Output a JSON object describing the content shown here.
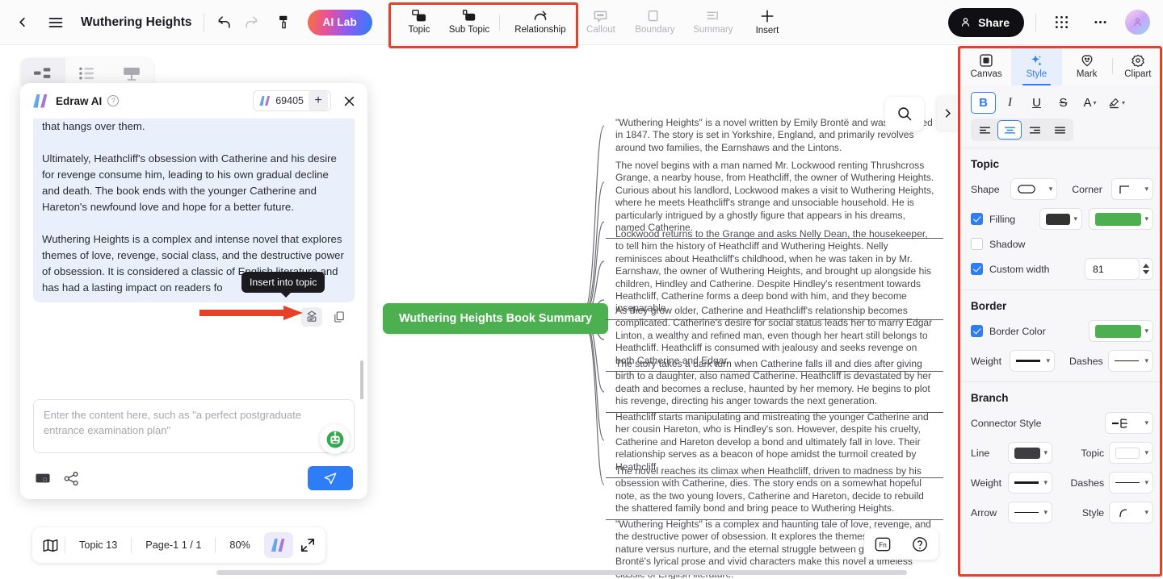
{
  "topbar": {
    "back_icon": "chevron-left-icon",
    "menu_icon": "hamburger-menu-icon",
    "doc_title": "Wuthering Heights",
    "undo_icon": "undo-icon",
    "redo_icon": "redo-icon",
    "format_painter_icon": "format-painter-icon",
    "ai_lab_label": "AI Lab",
    "tools": [
      {
        "label": "Topic",
        "icon": "topic-icon",
        "disabled": false
      },
      {
        "label": "Sub Topic",
        "icon": "sub-topic-icon",
        "disabled": false
      },
      {
        "label": "Relationship",
        "icon": "relationship-icon",
        "disabled": false
      },
      {
        "label": "Callout",
        "icon": "callout-icon",
        "disabled": true
      },
      {
        "label": "Boundary",
        "icon": "boundary-icon",
        "disabled": true
      },
      {
        "label": "Summary",
        "icon": "summary-icon",
        "disabled": true
      },
      {
        "label": "Insert",
        "icon": "insert-plus-icon",
        "disabled": false
      }
    ],
    "share_label": "Share",
    "share_icon": "person-icon",
    "apps_icon": "grid-apps-icon",
    "more_icon": "more-horizontal-icon",
    "avatar_icon": "user-avatar"
  },
  "canvas": {
    "view_tabs": [
      {
        "name": "mindmap-view",
        "icon": "mindmap-icon",
        "active": true
      },
      {
        "name": "outline-view",
        "icon": "outline-list-icon",
        "active": false
      },
      {
        "name": "presentation-view",
        "icon": "presentation-icon",
        "active": false
      }
    ],
    "search_icon": "search-icon",
    "collapse_icon": "chevron-right-icon",
    "root_topic": "Wuthering Heights Book Summary",
    "root_color": "#4caf50",
    "nodes": [
      "\"Wuthering Heights\" is a novel written by Emily Brontë and was published in 1847. The story is set in Yorkshire, England, and primarily revolves around two families, the Earnshaws and the Lintons.",
      "The novel begins with a man named Mr. Lockwood renting Thrushcross Grange, a nearby house, from Heathcliff, the owner of Wuthering Heights. Curious about his landlord, Lockwood makes a visit to Wuthering Heights, where he meets Heathcliff's strange and unsociable household. He is particularly intrigued by a ghostly figure that appears in his dreams, named Catherine.",
      "Lockwood returns to the Grange and asks Nelly Dean, the housekeeper, to tell him the history of Heathcliff and Wuthering Heights. Nelly reminisces about Heathcliff's childhood, when he was taken in by Mr. Earnshaw, the owner of Wuthering Heights, and brought up alongside his children, Hindley and Catherine. Despite Hindley's resentment towards Heathcliff, Catherine forms a deep bond with him, and they become inseparable.",
      "As they grow older, Catherine and Heathcliff's relationship becomes complicated. Catherine's desire for social status leads her to marry Edgar Linton, a wealthy and refined man, even though her heart still belongs to Heathcliff. Heathcliff is consumed with jealousy and seeks revenge on both Catherine and Edgar.",
      "The story takes a dark turn when Catherine falls ill and dies after giving birth to a daughter, also named Catherine. Heathcliff is devastated by her death and becomes a recluse, haunted by her memory. He begins to plot his revenge, directing his anger towards the next generation.",
      "Heathcliff starts manipulating and mistreating the younger Catherine and her cousin Hareton, who is Hindley's son. However, despite his cruelty, Catherine and Hareton develop a bond and ultimately fall in love. Their relationship serves as a beacon of hope amidst the turmoil created by Heathcliff.",
      "The novel reaches its climax when Heathcliff, driven to madness by his obsession with Catherine, dies. The story ends on a somewhat hopeful note, as the two young lovers, Catherine and Hareton, decide to rebuild the shattered family bond and bring peace to Wuthering Heights.",
      "\"Wuthering Heights\" is a complex and haunting tale of love, revenge, and the destructive power of obsession. It explores the themes of social class, nature versus nurture, and the eternal struggle between good and evil. Brontë's lyrical prose and vivid characters make this novel a timeless classic of English literature."
    ]
  },
  "ai_panel": {
    "logo_icon": "edraw-logo-icon",
    "title": "Edraw AI",
    "help_icon": "help-circle-icon",
    "credits_value": "69405",
    "credits_icon": "edraw-mini-logo-icon",
    "add_credits_icon": "plus-icon",
    "close_icon": "close-icon",
    "message_paragraphs": [
      "acles they face, the young couple attempts to build a relationship and overcome the legacy of hatred and revenge that hangs over them.",
      "Ultimately, Heathcliff's obsession with Catherine and his desire for revenge consume him, leading to his own gradual decline and death. The book ends with the younger Catherine and Hareton's newfound love and hope for a better future.",
      "Wuthering Heights is a complex and intense novel that explores themes of love, revenge, social class, and the destructive power of obsession. It is considered a classic of English literature and has had a lasting impact on readers fo"
    ],
    "tooltip": "Insert into topic",
    "insert_icon": "insert-into-topic-icon",
    "copy_icon": "copy-icon",
    "input_placeholder": "Enter the content here, such as \"a perfect postgraduate entrance examination plan\"",
    "input_value": "",
    "robot_icon": "ai-robot-icon",
    "attach_icon": "image-upload-icon",
    "flow_icon": "flowchart-icon",
    "send_icon": "send-paper-plane-icon",
    "send_color": "#2f7df6"
  },
  "right_panel": {
    "tabs": [
      {
        "label": "Canvas",
        "icon": "canvas-icon",
        "active": false
      },
      {
        "label": "Style",
        "icon": "style-sparkle-icon",
        "active": true
      },
      {
        "label": "Mark",
        "icon": "mark-smiley-icon",
        "active": false
      },
      {
        "label": "Clipart",
        "icon": "clipart-icon",
        "active": false
      }
    ],
    "format": {
      "bold": {
        "label": "B",
        "icon": "bold-icon",
        "active": true
      },
      "italic": {
        "label": "I",
        "icon": "italic-icon",
        "active": false
      },
      "underline": {
        "label": "U",
        "icon": "underline-icon",
        "active": false
      },
      "strikethrough": {
        "label": "S",
        "icon": "strikethrough-icon",
        "active": false
      },
      "font_color": {
        "label": "A",
        "icon": "font-color-icon",
        "active": false
      },
      "highlight": {
        "icon": "highlighter-icon",
        "active": false
      },
      "align": [
        {
          "name": "align-left",
          "active": false
        },
        {
          "name": "align-center",
          "active": true
        },
        {
          "name": "align-right",
          "active": false
        },
        {
          "name": "align-justify",
          "active": false
        }
      ]
    },
    "topic": {
      "title": "Topic",
      "shape_label": "Shape",
      "shape_icon": "rounded-rect-shape-icon",
      "corner_label": "Corner",
      "corner_icon": "square-corner-icon",
      "filling_label": "Filling",
      "filling_checked": true,
      "filling_text_color": "#333333",
      "filling_fill_color": "#4caf50",
      "shadow_label": "Shadow",
      "shadow_checked": false,
      "custom_width_label": "Custom width",
      "custom_width_checked": true,
      "custom_width_value": "81"
    },
    "border": {
      "title": "Border",
      "color_label": "Border Color",
      "color_checked": true,
      "color_value": "#4caf50",
      "weight_label": "Weight",
      "dashes_label": "Dashes"
    },
    "branch": {
      "title": "Branch",
      "connector_style_label": "Connector Style",
      "connector_icon": "connector-style-icon",
      "line_label": "Line",
      "line_color": "#3d3d42",
      "topic_label": "Topic",
      "topic_color": "#ffffff",
      "weight_label": "Weight",
      "dashes_label": "Dashes",
      "arrow_label": "Arrow",
      "style_label": "Style",
      "style_icon": "curve-style-icon"
    }
  },
  "statusbar": {
    "map_icon": "outline-map-icon",
    "topic_count": "Topic 13",
    "page_info": "Page-1  1 / 1",
    "zoom": "80%",
    "ai_icon": "edraw-ai-icon",
    "fullscreen_icon": "fullscreen-icon",
    "fn_label": "Fn",
    "fn_icon": "fn-key-icon",
    "help_icon": "help-circle-icon"
  },
  "annotations": {
    "toolbar_highlight": "red-rectangle-toolbar",
    "panel_highlight": "red-rectangle-style-panel",
    "arrow": "red-arrow-pointing-insert"
  }
}
